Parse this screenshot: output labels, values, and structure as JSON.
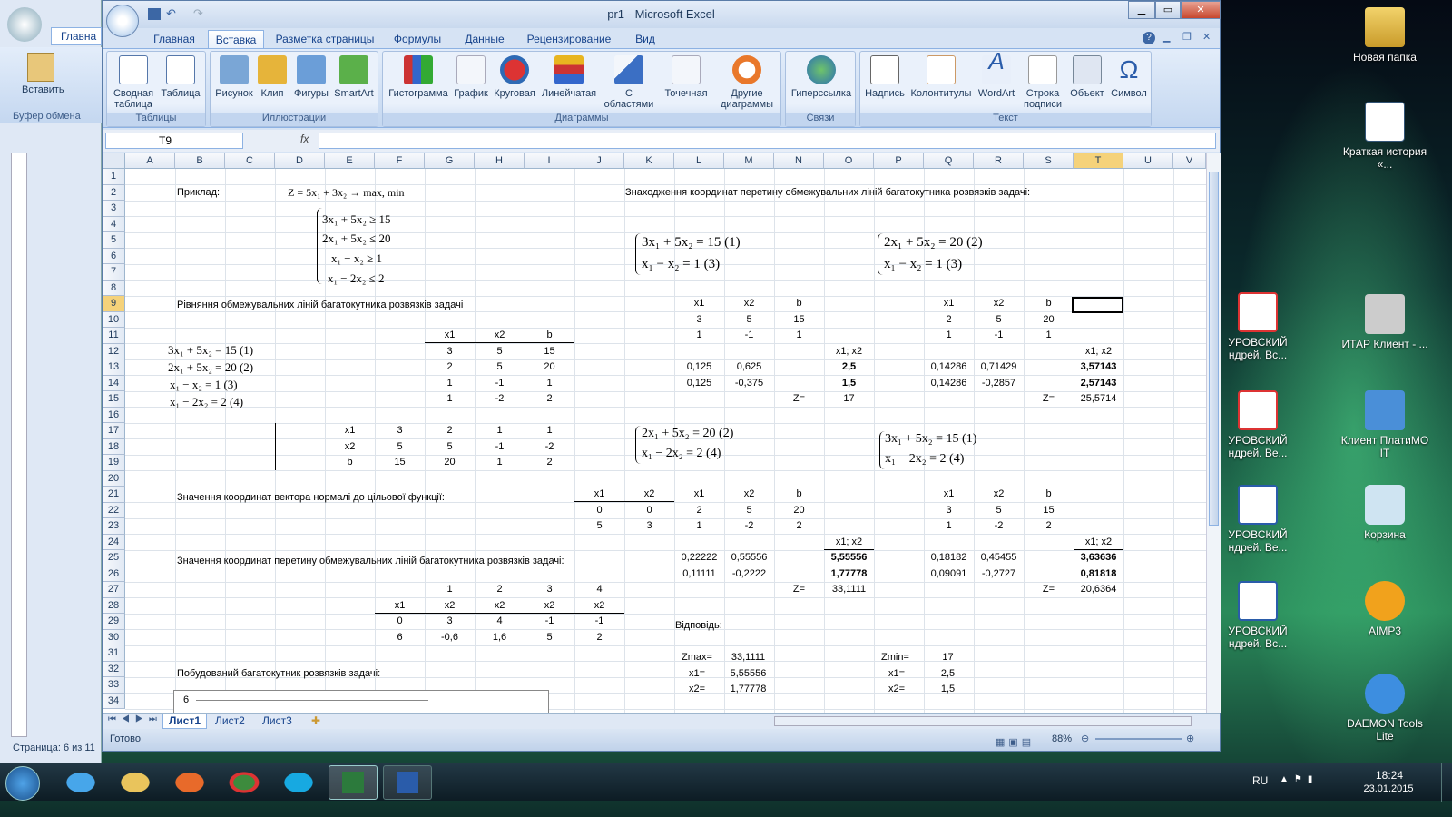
{
  "window": {
    "title": "pr1 - Microsoft Excel",
    "help": "?",
    "min": "▁",
    "max": "▭",
    "close": "✕"
  },
  "left_window": {
    "tab": "Главна",
    "paste": "Вставить",
    "clipboard": "Буфер обмена",
    "status": "Страница: 6 из 11"
  },
  "ribbon_tabs": [
    "Главная",
    "Вставка",
    "Разметка страницы",
    "Формулы",
    "Данные",
    "Рецензирование",
    "Вид"
  ],
  "ribbon": {
    "tables": {
      "label": "Таблицы",
      "b1": "Сводная таблица",
      "b2": "Таблица"
    },
    "illus": {
      "label": "Иллюстрации",
      "b1": "Рисунок",
      "b2": "Клип",
      "b3": "Фигуры",
      "b4": "SmartArt"
    },
    "charts": {
      "label": "Диаграммы",
      "b1": "Гистограмма",
      "b2": "График",
      "b3": "Круговая",
      "b4": "Линейчатая",
      "b5": "С областями",
      "b6": "Точечная",
      "b7": "Другие диаграммы"
    },
    "links": {
      "label": "Связи",
      "b1": "Гиперссылка"
    },
    "text": {
      "label": "Текст",
      "b1": "Надпись",
      "b2": "Колонтитулы",
      "b3": "WordArt",
      "b4": "Строка подписи",
      "b5": "Объект",
      "b6": "Символ"
    }
  },
  "namebox": "T9",
  "fx": "fx",
  "columns": [
    "A",
    "B",
    "C",
    "D",
    "E",
    "F",
    "G",
    "H",
    "I",
    "J",
    "K",
    "L",
    "M",
    "N",
    "O",
    "P",
    "Q",
    "R",
    "S",
    "T",
    "U",
    "V"
  ],
  "rows": [
    "1",
    "2",
    "3",
    "4",
    "5",
    "6",
    "7",
    "8",
    "9",
    "10",
    "11",
    "12",
    "13",
    "14",
    "15",
    "16",
    "17",
    "18",
    "19",
    "20",
    "21",
    "22",
    "23",
    "24",
    "25",
    "26",
    "27",
    "28",
    "29",
    "30",
    "31",
    "32",
    "33",
    "34"
  ],
  "cells": {
    "b2": "Приклад:",
    "z": "Z = 5x₁ + 3x₂ → max, min",
    "sys1": "3x₁ + 5x₂ ≥ 15",
    "sys2": "2x₁ + 5x₂ ≤ 20",
    "sys3": "x₁ − x₂ ≥ 1",
    "sys4": "x₁ − 2x₂ ≤ 2",
    "k2": "Знаходження координат перетину обмежувальних ліній багатокутника розвязків задачі:",
    "b9": "Рівняння обмежувальних ліній багатокутника розвязків задачі",
    "eq1": "3x₁ + 5x₂ = 15    (1)",
    "eq2": "2x₁ + 5x₂ = 20    (2)",
    "eq3": "x₁ − x₂ = 1         (3)",
    "eq4": "x₁ − 2x₂ = 2      (4)",
    "sA1": "3x₁ + 5x₂ = 15    (1)",
    "sA2": "x₁ − x₂ = 1           (3)",
    "sB1": "2x₁ + 5x₂ = 20   (2)",
    "sB2": "x₁ − x₂ = 1          (3)",
    "sC1": "2x₁ + 5x₂ = 20   (2)",
    "sC2": "x₁ − 2x₂ = 2       (4)",
    "sD1": "3x₁ + 5x₂ = 15    (1)",
    "sD2": "x₁ − 2x₂ = 2      (4)",
    "b21": "Значення координат вектора нормалі до цільової функції:",
    "b25": "Значення координат перетину обмежувальних ліній багатокутника розвязків задачі:",
    "b32": "Побудований багатокутник розвязків задачі:",
    "l29": "Відповідь:",
    "zmax": "Zmax=",
    "zmaxv": "33,1111",
    "zmin": "Zmin=",
    "zminv": "17",
    "x1a": "x1=",
    "x1av": "5,55556",
    "x2a": "x2=",
    "x2av": "1,77778",
    "x1b": "x1=",
    "x1bv": "2,5",
    "x2b": "x2=",
    "x2bv": "1,5",
    "chart6": "6"
  },
  "status": {
    "ready": "Готово",
    "zoom": "88%"
  },
  "sheets": [
    "Лист1",
    "Лист2",
    "Лист3"
  ],
  "desktop": [
    "Новая папка",
    "Краткая история «...",
    "ИТАР Клиент - ...",
    "Клиент ПлатиМО IT",
    "Корзина",
    "AIMP3",
    "DAEMON Tools Lite",
    "УРОВСКИЙ ндрей. Вс...",
    "УРОВСКИЙ ндрей. Ве...",
    "УРОВСКИЙ ндрей. Ве...",
    "УРОВСКИЙ ндрей. Вс..."
  ],
  "tray": {
    "lang": "RU",
    "time": "18:24",
    "date": "23.01.2015"
  }
}
